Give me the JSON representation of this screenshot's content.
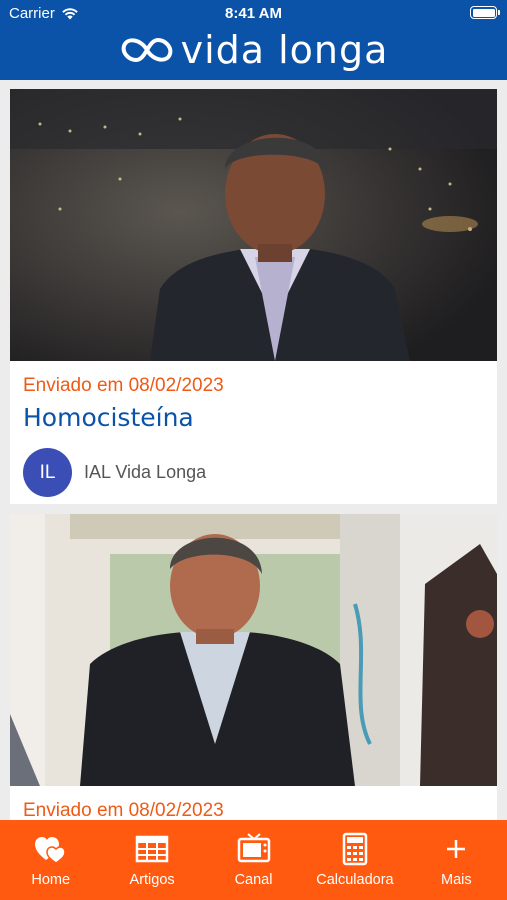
{
  "status_bar": {
    "carrier": "Carrier",
    "time": "8:41 AM"
  },
  "brand": {
    "name": "vida longa"
  },
  "posts": [
    {
      "date": "Enviado em 08/02/2023",
      "title": "Homocisteína",
      "author_initials": "IL",
      "author": "IAL Vida Longa"
    },
    {
      "date": "Enviado em 08/02/2023"
    }
  ],
  "tabbar": {
    "items": [
      {
        "label": "Home",
        "icon": "hearts-icon"
      },
      {
        "label": "Artigos",
        "icon": "table-icon"
      },
      {
        "label": "Canal",
        "icon": "tv-icon"
      },
      {
        "label": "Calculadora",
        "icon": "calculator-icon"
      },
      {
        "label": "Mais",
        "icon": "plus-icon"
      }
    ]
  },
  "colors": {
    "header": "#0a53a8",
    "accent": "#ff5a10",
    "date": "#ef5a16",
    "title": "#0a53a8",
    "avatar": "#3b4eb6"
  }
}
